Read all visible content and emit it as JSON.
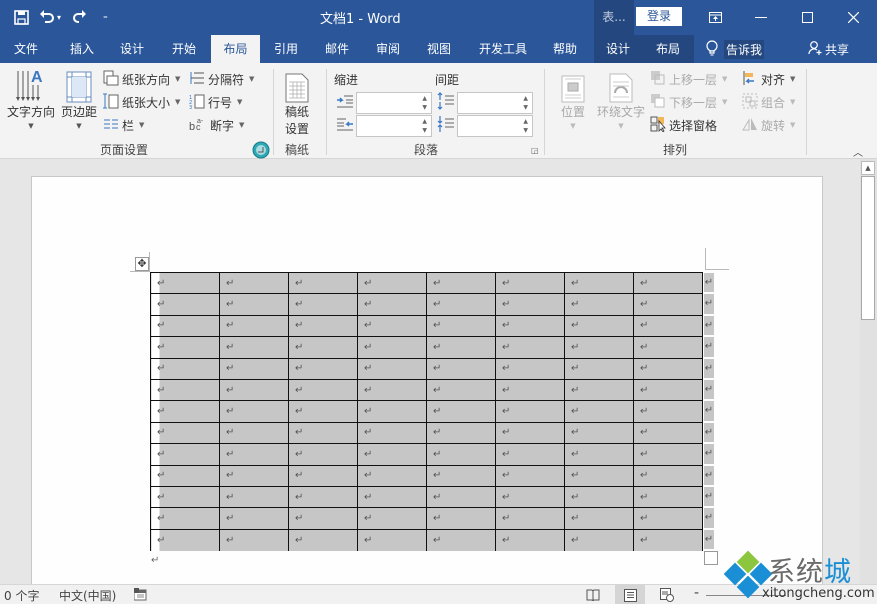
{
  "window": {
    "title": "文档1  -  Word",
    "context_title": "表...",
    "login_label": "登录",
    "controls": [
      "ribbon-display-icon",
      "minimize-icon",
      "maximize-icon",
      "close-icon"
    ]
  },
  "qat": {
    "save_icon": "save-icon",
    "undo_icon": "undo-icon",
    "redo_icon": "redo-icon",
    "customize_icon": "customize-icon"
  },
  "tabs": [
    {
      "label": "文件"
    },
    {
      "label": "插入"
    },
    {
      "label": "设计"
    },
    {
      "label": "开始"
    },
    {
      "label": "布局",
      "active": true
    },
    {
      "label": "引用"
    },
    {
      "label": "邮件"
    },
    {
      "label": "审阅"
    },
    {
      "label": "视图"
    },
    {
      "label": "开发工具"
    },
    {
      "label": "帮助"
    },
    {
      "label": "设计",
      "contextual": true
    },
    {
      "label": "布局",
      "contextual": true
    }
  ],
  "tellme": {
    "label": "告诉我"
  },
  "share": {
    "label": "共享"
  },
  "ribbon": {
    "page_setup": {
      "label": "页面设置",
      "text_direction": "文字方向",
      "margins": "页边距",
      "orientation": "纸张方向",
      "size": "纸张大小",
      "columns": "栏",
      "breaks": "分隔符",
      "line_numbers": "行号",
      "hyphenation": "断字"
    },
    "manuscript": {
      "label": "稿纸",
      "setup_line1": "稿纸",
      "setup_line2": "设置"
    },
    "paragraph": {
      "label": "段落",
      "indent_label": "缩进",
      "spacing_label": "间距",
      "indent_left": "",
      "indent_right": "",
      "spacing_before": "",
      "spacing_after": ""
    },
    "arrange": {
      "label": "排列",
      "position": "位置",
      "wrap_text": "环绕文字",
      "bring_forward": "上移一层",
      "send_backward": "下移一层",
      "selection_pane": "选择窗格",
      "align": "对齐",
      "group": "组合",
      "rotate": "旋转"
    }
  },
  "document": {
    "table": {
      "rows": 13,
      "columns": 8,
      "cell_mark": "↵"
    },
    "paragraph_mark": "↵"
  },
  "status": {
    "word_count": "0 个字",
    "language": "中文(中国)",
    "zoom_minus": "-"
  },
  "watermark": {
    "text_gray": "系统",
    "text_blue": "城",
    "url": "xitongcheng.com"
  }
}
